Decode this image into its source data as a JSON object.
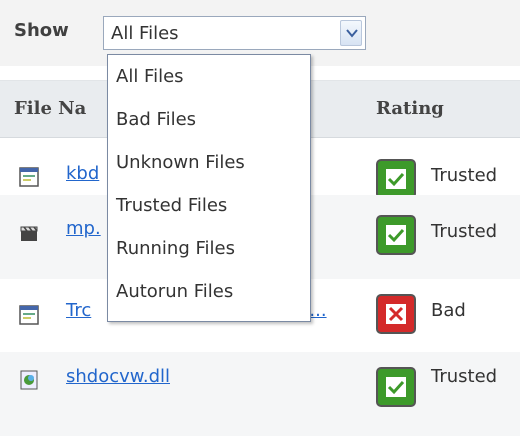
{
  "toolbar": {
    "show_label": "Show",
    "filter_value": "All Files"
  },
  "dropdown": {
    "options": [
      "All Files",
      "Bad Files",
      "Unknown Files",
      "Trusted Files",
      "Running Files",
      "Autorun Files"
    ]
  },
  "table": {
    "headers": {
      "file_name": "File Na",
      "rating": "Rating"
    },
    "rows": [
      {
        "file_name": "kbd",
        "rating": "Trusted",
        "icon": "window-app-icon",
        "rating_icon": "check-icon"
      },
      {
        "file_name": "mp.",
        "rating": "Trusted",
        "icon": "clapperboard-icon",
        "rating_icon": "check-icon"
      },
      {
        "file_name": "Trc",
        "file_name_tail": "n...",
        "rating": "Bad",
        "icon": "window-app-icon",
        "rating_icon": "x-icon"
      },
      {
        "file_name": "shdocvw.dll",
        "rating": "Trusted",
        "icon": "dll-icon",
        "rating_icon": "check-icon"
      }
    ]
  },
  "colors": {
    "trusted": "#3d9a2a",
    "bad": "#d42a2a",
    "link": "#2266cc"
  }
}
